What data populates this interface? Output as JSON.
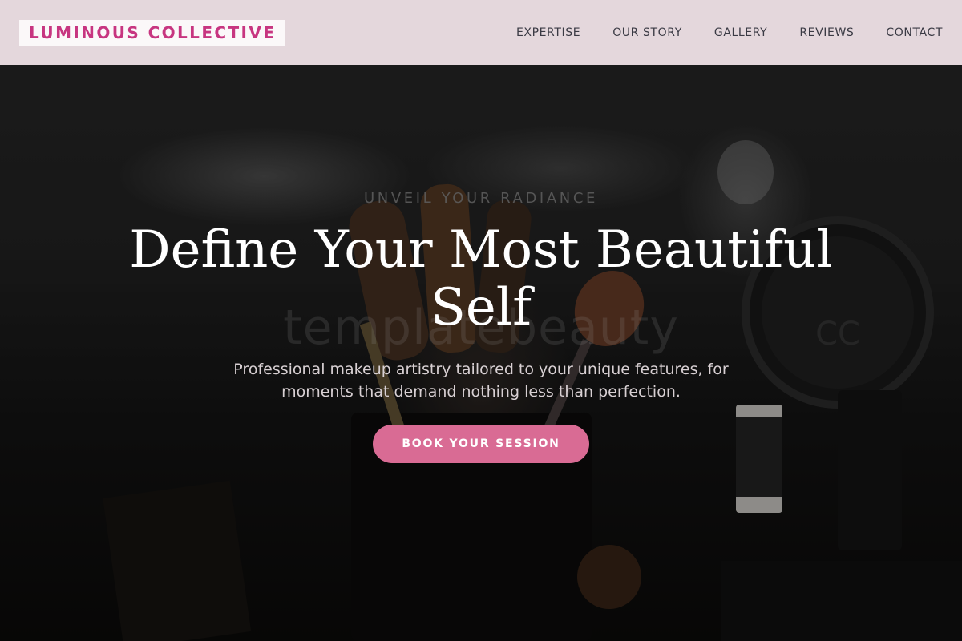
{
  "brand": {
    "logo_text": "LUMINOUS COLLECTIVE"
  },
  "nav": {
    "items": [
      {
        "label": "EXPERTISE"
      },
      {
        "label": "OUR STORY"
      },
      {
        "label": "GALLERY"
      },
      {
        "label": "REVIEWS"
      },
      {
        "label": "CONTACT"
      }
    ]
  },
  "hero": {
    "eyebrow": "UNVEIL YOUR RADIANCE",
    "headline": "Define Your Most Beautiful Self",
    "subtext": "Professional makeup artistry tailored to your unique features, for moments that demand nothing less than perfection.",
    "cta_label": "BOOK YOUR SESSION",
    "watermark": "templatebeauty"
  },
  "colors": {
    "brand_accent": "#c73580",
    "cta_background": "#d96b94",
    "header_background": "#ecdfe4"
  }
}
